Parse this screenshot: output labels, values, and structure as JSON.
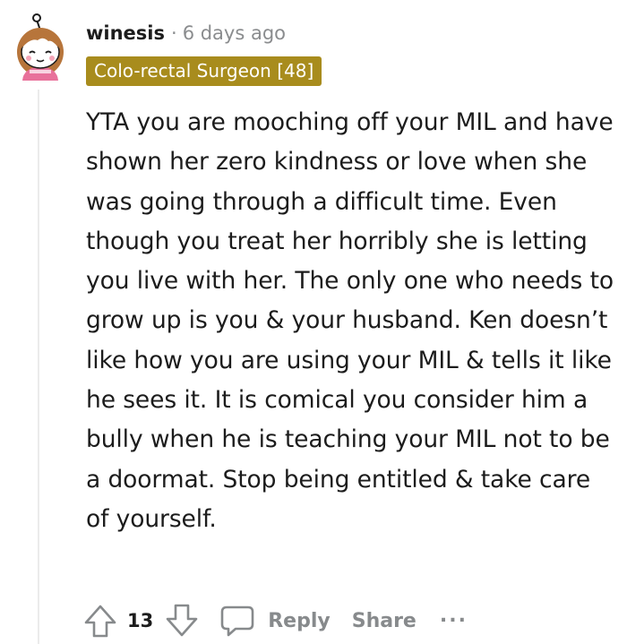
{
  "comment": {
    "username": "winesis",
    "separator": "·",
    "timestamp": "6 days ago",
    "flair": "Colo-rectal Surgeon [48]",
    "body": "YTA you are mooching off your MIL and have shown her zero kindness or love when she was going through a difficult time. Even though you treat her horribly she is letting you live with her. The only one who needs to grow up is you & your husband. Ken doesn’t like how you are using your MIL & tells it like he sees it. It is comical you consider him a bully when he is teaching your MIL not to be a doormat. Stop being entitled & take care of yourself.",
    "avatar_icon": "snoo-avatar-icon",
    "flair_color": "#a88c1d"
  },
  "actions": {
    "vote_count": "13",
    "upvote_icon": "upvote-arrow-icon",
    "downvote_icon": "downvote-arrow-icon",
    "reply_icon": "speech-bubble-icon",
    "reply_label": "Reply",
    "share_label": "Share",
    "more_label": "..."
  }
}
